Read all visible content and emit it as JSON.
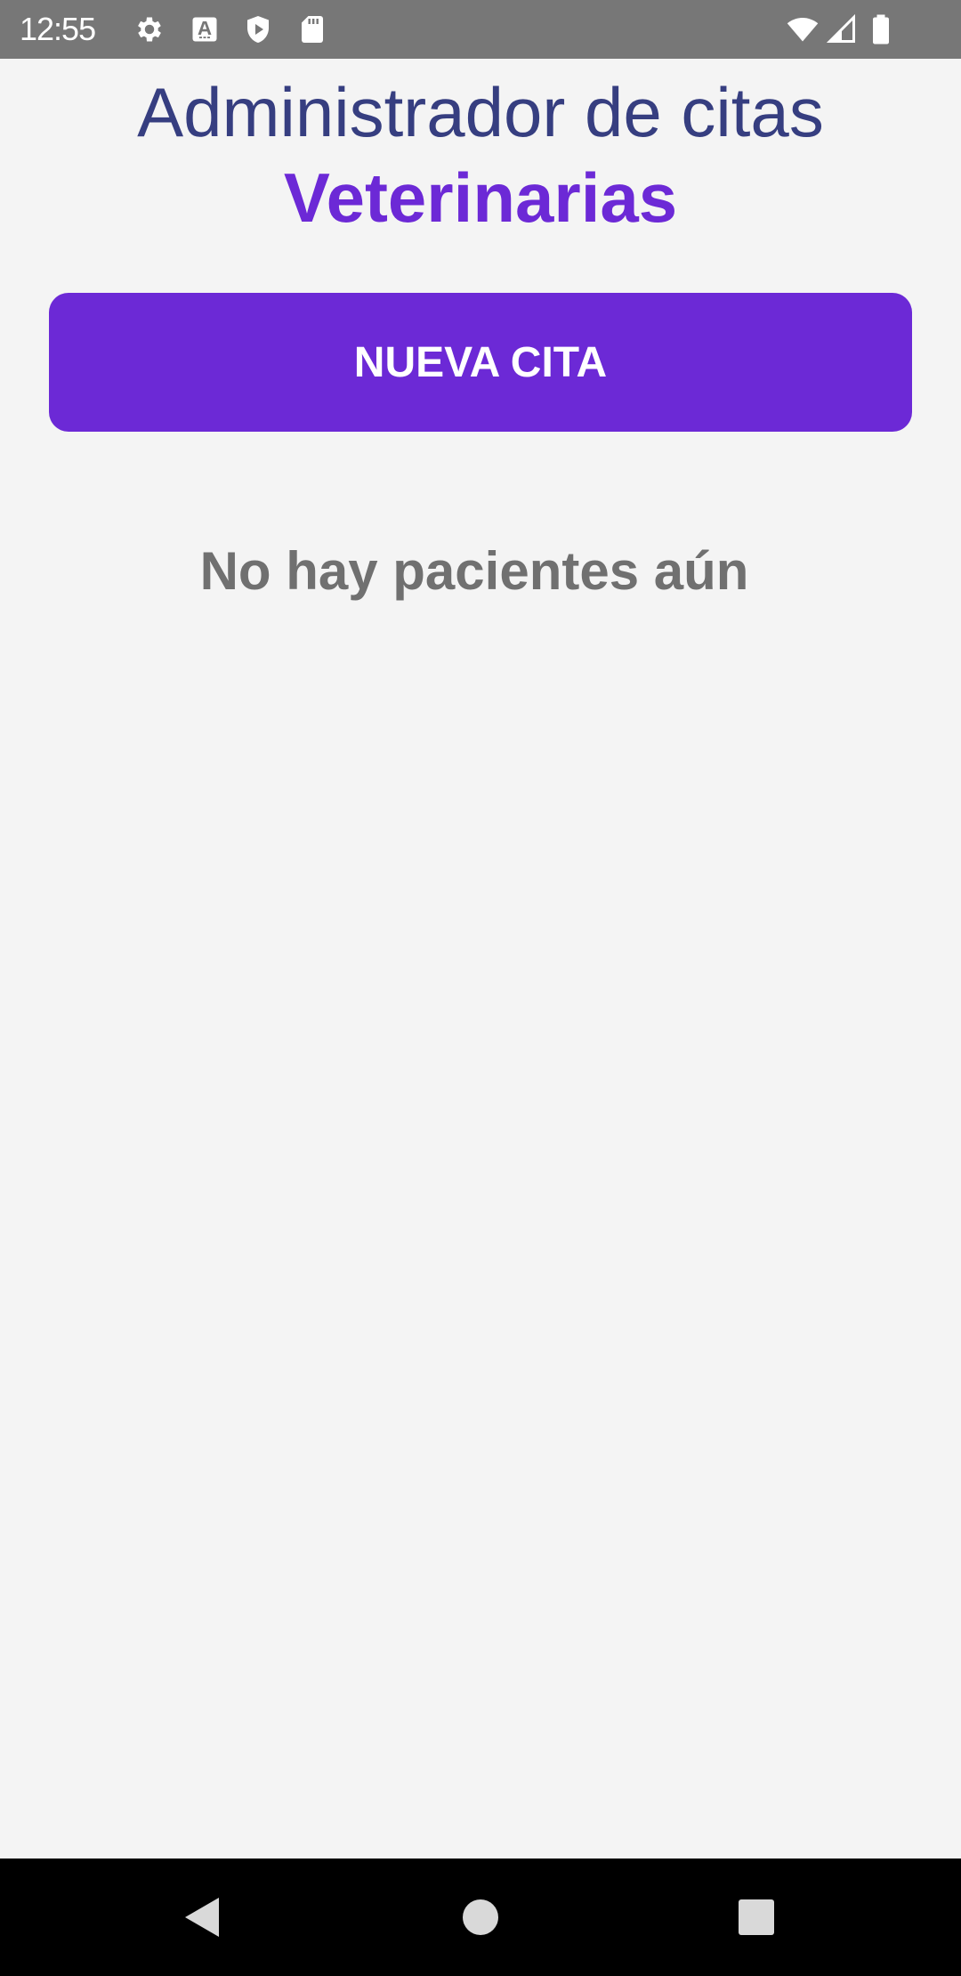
{
  "status_bar": {
    "time": "12:55",
    "left_icons": [
      "gear-icon",
      "keyboard-a-icon",
      "play-protect-icon",
      "sd-card-icon"
    ],
    "right_icons": [
      "wifi-icon",
      "cell-signal-icon",
      "battery-icon"
    ]
  },
  "header": {
    "title": "Administrador de citas",
    "title_accent": "Veterinarias"
  },
  "actions": {
    "new_appointment_label": "NUEVA CITA"
  },
  "patients": {
    "empty_message": "No hay pacientes aún",
    "items": []
  },
  "nav_bar": {
    "buttons": [
      "back-icon",
      "home-icon",
      "recents-icon"
    ]
  },
  "colors": {
    "title": "#363e80",
    "accent": "#6c29d6",
    "empty_text": "#707070",
    "background": "#f4f4f4",
    "status_bar": "#777777"
  }
}
